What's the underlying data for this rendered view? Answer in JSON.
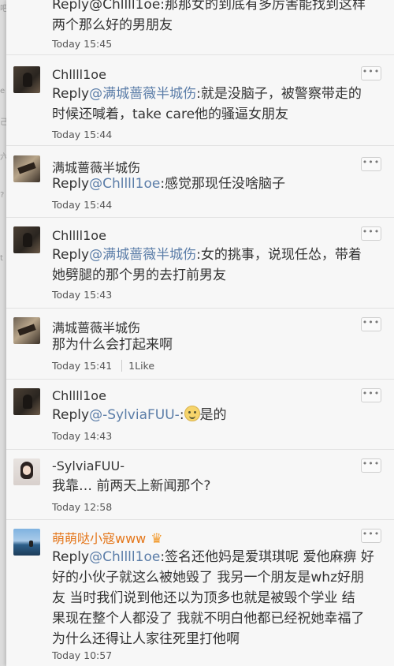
{
  "left_strip": [
    "吧",
    "e",
    "己",
    "六",
    "?",
    "t"
  ],
  "comments": [
    {
      "line1": "Reply@Chllll1oe:那那女的到底有多厉害能找到这样",
      "line2": "两个那么好的男朋友",
      "time": "Today 15:45"
    },
    {
      "name": "Chllll1oe",
      "reply_label": "Reply",
      "mention": "@满城蔷薇半城伤",
      "text_line1_rest": ":就是没脑子，被警察带走的",
      "text_line2": "时候还喊着，take care他的骚逼女朋友",
      "time": "Today 15:44",
      "more": "•••"
    },
    {
      "name": "满城蔷薇半城伤",
      "reply_label": "Reply",
      "mention": "@Chllll1oe",
      "text_line1_rest": ":感觉那现任没啥脑子",
      "time": "Today 15:44",
      "more": "•••"
    },
    {
      "name": "Chllll1oe",
      "reply_label": "Reply",
      "mention": "@满城蔷薇半城伤",
      "text_line1_rest": ":女的挑事，说现任怂，带着",
      "text_line2": "她劈腿的那个男的去打前男友",
      "time": "Today 15:43",
      "more": "•••"
    },
    {
      "name": "满城蔷薇半城伤",
      "text_line1": "那为什么会打起来啊",
      "time": "Today 15:41",
      "likes": "1Like",
      "more": "•••"
    },
    {
      "name": "Chllll1oe",
      "reply_label": "Reply",
      "mention": "@-SylviaFUU-",
      "text_line1_rest": ":",
      "text_after_emoji": "是的",
      "time": "Today 14:43",
      "more": "•••"
    },
    {
      "name": "-SylviaFUU-",
      "text_line1": "我靠… 前两天上新闻那个?",
      "time": "Today 12:58",
      "more": "•••"
    },
    {
      "name": "萌萌哒小寇www",
      "crown": "♛",
      "reply_label": "Reply",
      "mention": "@Chllll1oe",
      "text_line1_rest": ":签名还他妈是爱琪琪呢 爱他麻痹 好",
      "text_line2": "好的小伙子就这么被她毁了 我另一个朋友是whz好朋",
      "text_line3": "友 当时我们说到他还以为顶多也就是被毁个学业 结",
      "text_line4": "果现在整个人都没了 我就不明白他都已经祝她幸福了",
      "text_line5": "为什么还得让人家往死里打他啊",
      "time": "Today 10:57",
      "more": "•••"
    }
  ]
}
